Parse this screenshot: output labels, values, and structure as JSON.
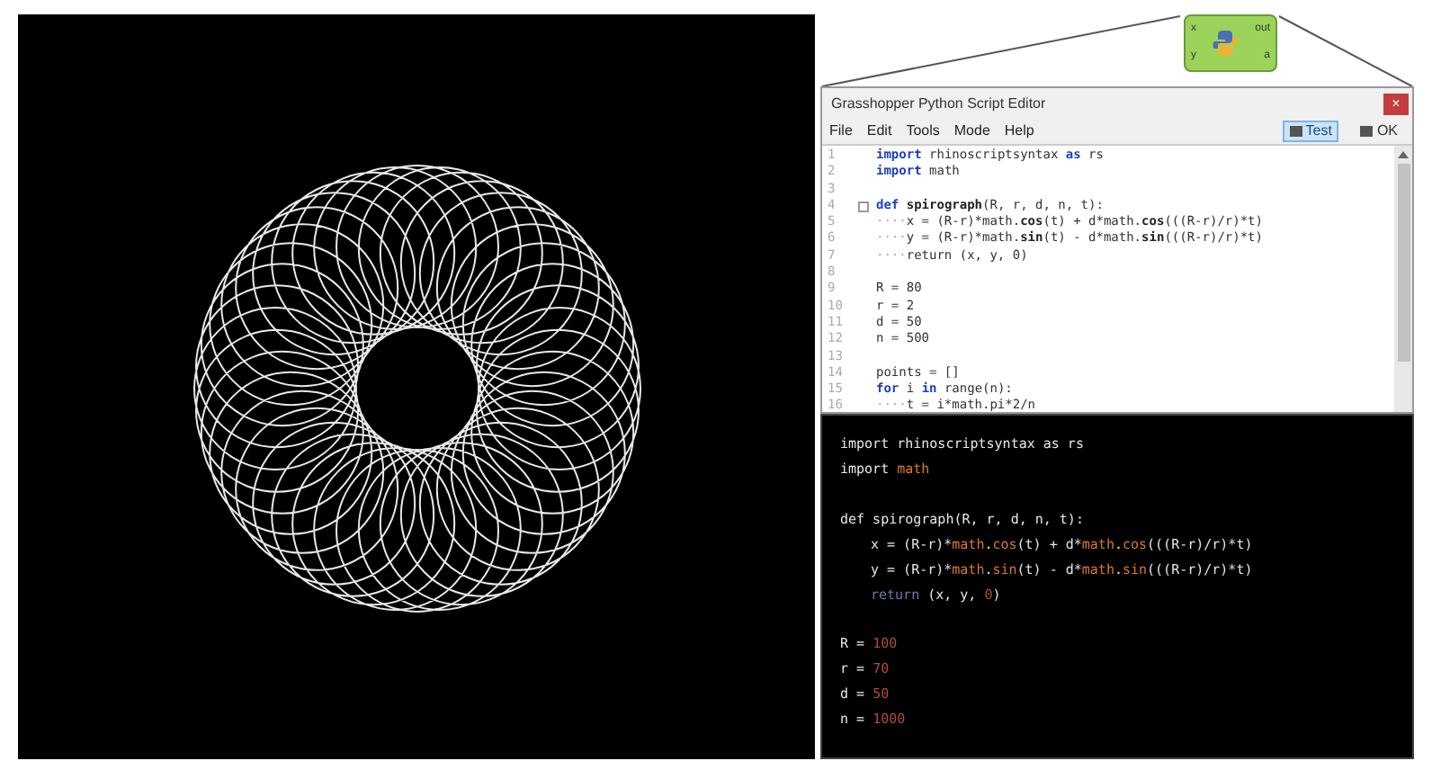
{
  "component": {
    "inputs": [
      "x",
      "y"
    ],
    "outputs": [
      "out",
      "a"
    ]
  },
  "editor": {
    "title": "Grasshopper Python Script Editor",
    "close": "×",
    "menu": [
      "File",
      "Edit",
      "Tools",
      "Mode",
      "Help"
    ],
    "buttons": [
      {
        "label": "Test",
        "selected": true
      },
      {
        "label": "OK",
        "selected": false
      }
    ],
    "lines": [
      {
        "number": "1",
        "segments": [
          {
            "kind": "kw",
            "text": "import"
          },
          {
            "kind": "plain",
            "text": " rhinoscriptsyntax "
          },
          {
            "kind": "kw",
            "text": "as"
          },
          {
            "kind": "plain",
            "text": " rs"
          }
        ]
      },
      {
        "number": "2",
        "segments": [
          {
            "kind": "kw",
            "text": "import"
          },
          {
            "kind": "plain",
            "text": " math"
          }
        ]
      },
      {
        "number": "3"
      },
      {
        "number": "4",
        "fold": true,
        "segments": [
          {
            "kind": "kw",
            "text": "def"
          },
          {
            "kind": "bold",
            "text": " spirograph"
          },
          {
            "kind": "plain",
            "text": "(R, r, d, n, t):"
          }
        ]
      },
      {
        "number": "5",
        "segments": [
          {
            "kind": "dots",
            "text": "····"
          },
          {
            "kind": "plain",
            "text": "x = (R-r)*math."
          },
          {
            "kind": "bold",
            "text": "cos"
          },
          {
            "kind": "plain",
            "text": "(t) + d*math."
          },
          {
            "kind": "bold",
            "text": "cos"
          },
          {
            "kind": "plain",
            "text": "(((R-r)/r)*t)"
          }
        ]
      },
      {
        "number": "6",
        "segments": [
          {
            "kind": "dots",
            "text": "····"
          },
          {
            "kind": "plain",
            "text": "y = (R-r)*math."
          },
          {
            "kind": "bold",
            "text": "sin"
          },
          {
            "kind": "plain",
            "text": "(t) - d*math."
          },
          {
            "kind": "bold",
            "text": "sin"
          },
          {
            "kind": "plain",
            "text": "(((R-r)/r)*t)"
          }
        ]
      },
      {
        "number": "7",
        "segments": [
          {
            "kind": "dots",
            "text": "····"
          },
          {
            "kind": "plain",
            "text": "return (x, y, 0)"
          }
        ]
      },
      {
        "number": "8"
      },
      {
        "number": "9",
        "segments": [
          {
            "kind": "plain",
            "text": "R = 80"
          }
        ]
      },
      {
        "number": "10",
        "segments": [
          {
            "kind": "plain",
            "text": "r = 2"
          }
        ]
      },
      {
        "number": "11",
        "segments": [
          {
            "kind": "plain",
            "text": "d = 50"
          }
        ]
      },
      {
        "number": "12",
        "segments": [
          {
            "kind": "plain",
            "text": "n = 500"
          }
        ]
      },
      {
        "number": "13"
      },
      {
        "number": "14",
        "segments": [
          {
            "kind": "plain",
            "text": "points = []"
          }
        ]
      },
      {
        "number": "15",
        "segments": [
          {
            "kind": "kw",
            "text": "for"
          },
          {
            "kind": "plain",
            "text": " i "
          },
          {
            "kind": "kw",
            "text": "in"
          },
          {
            "kind": "plain",
            "text": " range(n):"
          }
        ]
      },
      {
        "number": "16",
        "segments": [
          {
            "kind": "dots",
            "text": "····"
          },
          {
            "kind": "plain",
            "text": "t = i*math.pi*2/n"
          }
        ]
      }
    ]
  },
  "code_panel": {
    "lines": [
      {
        "segments": [
          {
            "kind": "plain",
            "text": "import rhinoscriptsyntax as rs"
          }
        ]
      },
      {
        "segments": [
          {
            "kind": "plain",
            "text": "import "
          },
          {
            "kind": "mod",
            "text": "math"
          }
        ]
      },
      {
        "blank_before": true,
        "segments": [
          {
            "kind": "plain",
            "text": "def spirograph(R, r, d, n, t):"
          }
        ]
      },
      {
        "indent": true,
        "segments": [
          {
            "kind": "plain",
            "text": "x = (R-r)*"
          },
          {
            "kind": "mod",
            "text": "math"
          },
          {
            "kind": "plain",
            "text": "."
          },
          {
            "kind": "mod",
            "text": "cos"
          },
          {
            "kind": "plain",
            "text": "(t) + d*"
          },
          {
            "kind": "mod",
            "text": "math"
          },
          {
            "kind": "plain",
            "text": "."
          },
          {
            "kind": "mod",
            "text": "cos"
          },
          {
            "kind": "plain",
            "text": "(((R-r)/r)*t)"
          }
        ]
      },
      {
        "indent": true,
        "segments": [
          {
            "kind": "plain",
            "text": "y = (R-r)*"
          },
          {
            "kind": "mod",
            "text": "math"
          },
          {
            "kind": "plain",
            "text": "."
          },
          {
            "kind": "mod",
            "text": "sin"
          },
          {
            "kind": "plain",
            "text": "(t) - d*"
          },
          {
            "kind": "mod",
            "text": "math"
          },
          {
            "kind": "plain",
            "text": "."
          },
          {
            "kind": "mod",
            "text": "sin"
          },
          {
            "kind": "plain",
            "text": "(((R-r)/r)*t)"
          }
        ]
      },
      {
        "indent": true,
        "segments": [
          {
            "kind": "kw",
            "text": "return"
          },
          {
            "kind": "plain",
            "text": " (x, y, "
          },
          {
            "kind": "num",
            "text": "0"
          },
          {
            "kind": "plain",
            "text": ")"
          }
        ]
      },
      {
        "blank_before": true,
        "segments": [
          {
            "kind": "plain",
            "text": "R = "
          },
          {
            "kind": "num",
            "text": "100"
          }
        ]
      },
      {
        "segments": [
          {
            "kind": "plain",
            "text": "r = "
          },
          {
            "kind": "num",
            "text": "70"
          }
        ]
      },
      {
        "segments": [
          {
            "kind": "plain",
            "text": "d = "
          },
          {
            "kind": "num",
            "text": "50"
          }
        ]
      },
      {
        "segments": [
          {
            "kind": "plain",
            "text": "n = "
          },
          {
            "kind": "num",
            "text": "1000"
          }
        ]
      }
    ]
  }
}
